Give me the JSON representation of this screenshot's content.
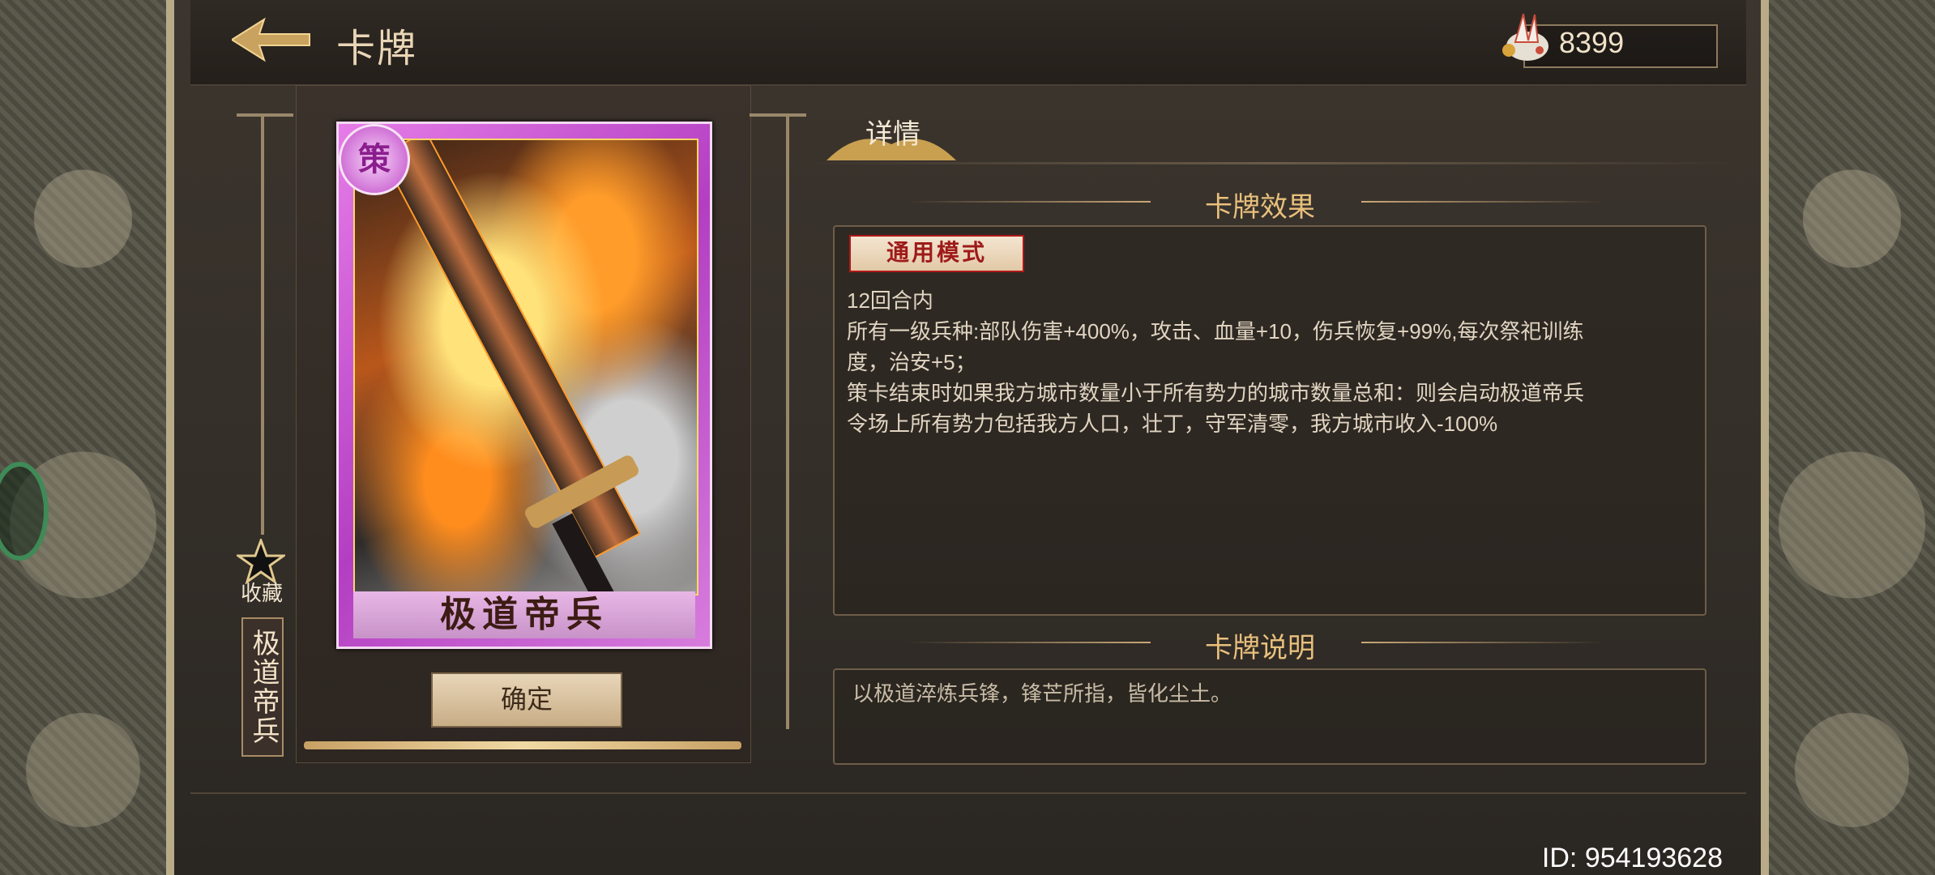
{
  "header": {
    "title": "卡牌",
    "currency_value": "8399"
  },
  "card": {
    "badge": "策",
    "name": "极道帝兵",
    "vertical_name": "极道帝兵",
    "favorite_label": "收藏",
    "confirm_label": "确定"
  },
  "detail": {
    "tab_label": "详情",
    "effect_heading": "卡牌效果",
    "mode_tag": "通用模式",
    "effect_lines": [
      "12回合内",
      "所有一级兵种:部队伤害+400%，攻击、血量+10，伤兵恢复+99%,每次祭祀训练",
      "度，治安+5；",
      "策卡结束时如果我方城市数量小于所有势力的城市数量总和：则会启动极道帝兵",
      "令场上所有势力包括我方人口，壮丁，守军清零，我方城市收入-100%"
    ],
    "desc_heading": "卡牌说明",
    "desc_text": "以极道淬炼兵锋，锋芒所指，皆化尘土。"
  },
  "footer": {
    "player_id": "ID: 954193628"
  },
  "icons": {
    "back": "back-arrow-icon",
    "currency": "feather-coin-icon",
    "favorite": "star-icon"
  },
  "colors": {
    "accent_gold": "#e8c07c",
    "card_purple": "#c048c9",
    "tag_red": "#b01818"
  }
}
